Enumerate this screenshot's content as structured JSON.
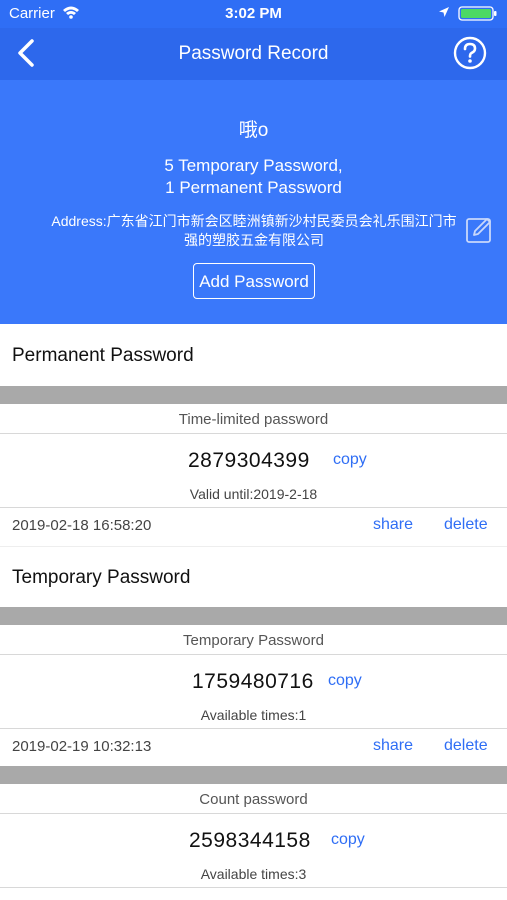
{
  "status_bar": {
    "carrier": "Carrier",
    "time": "3:02 PM",
    "icons": [
      "wifi-icon",
      "location-arrow-icon",
      "battery-icon"
    ]
  },
  "nav": {
    "title": "Password Record",
    "back_icon": "chevron-left-icon",
    "help_icon": "question-circle-icon"
  },
  "lock_info": {
    "name": "哦o",
    "temporary_count": "5 Temporary Password,",
    "permanent_count": "1 Permanent Password",
    "address": "Address:广东省江门市新会区睦洲镇新沙村民委员会礼乐围江门市强的塑胶五金有限公司",
    "edit_icon": "edit-icon",
    "add_button": "Add Password"
  },
  "sections": {
    "permanent_title": "Permanent Password",
    "temporary_title": "Temporary Password"
  },
  "records": [
    {
      "type": "Time-limited password",
      "password": "2879304399",
      "copy": "copy",
      "detail": "Valid until:2019-2-18",
      "date": "2019-02-18 16:58:20",
      "share": "share",
      "delete": "delete"
    },
    {
      "type": "Temporary Password",
      "password": "1759480716",
      "copy": "copy",
      "detail": "Available times:1",
      "date": "2019-02-19 10:32:13",
      "share": "share",
      "delete": "delete"
    },
    {
      "type": "Count password",
      "password": "2598344158",
      "copy": "copy",
      "detail": "Available times:3"
    }
  ],
  "colors": {
    "primary_blue": "#2f6ef5",
    "header_blue": "#3a78fa",
    "separator_gray": "#a9a9a9"
  }
}
